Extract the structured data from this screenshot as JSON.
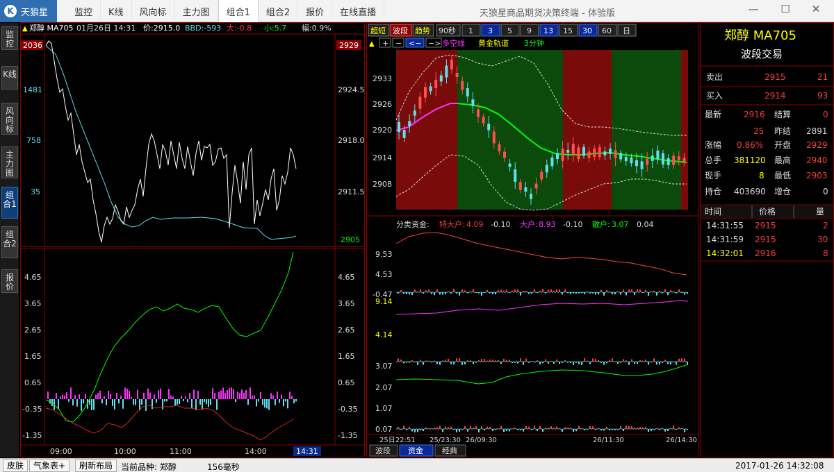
{
  "app": {
    "logo_text": "天狼星",
    "window_title": "天狼星商品期货决策终端 - 体验版",
    "logo_glyph": "K"
  },
  "nav": {
    "tabs": [
      {
        "label": "监控"
      },
      {
        "label": "K线"
      },
      {
        "label": "风向标"
      },
      {
        "label": "主力图"
      },
      {
        "label": "组合1"
      },
      {
        "label": "组合2"
      },
      {
        "label": "报价"
      },
      {
        "label": "在线直播"
      }
    ],
    "active": "组合1"
  },
  "window_controls": {
    "minimize": "—",
    "maximize": "☐",
    "close": "✕"
  },
  "sidebar": {
    "tabs": [
      "监控",
      "K线",
      "风向标",
      "主力图",
      "组合1",
      "组合2",
      "报价"
    ],
    "active": "组合1"
  },
  "intraday": {
    "header": {
      "symbol": "郑醇 MA705",
      "date": "01月26日 14:31",
      "price": "价:2915.0",
      "bbd": "BBD:-593",
      "big": "大:-0.8",
      "small": "小:5.7",
      "amp": "幅:0.9%"
    },
    "left_axis": [
      "2036",
      "1481",
      "758",
      "35"
    ],
    "right_axis": [
      "2929",
      "2924.5",
      "2918.0",
      "2911.5",
      "2905"
    ],
    "bottom_left_axis": [
      "4.65",
      "3.65",
      "2.65",
      "1.65",
      "0.65",
      "-0.35",
      "-1.35"
    ],
    "bottom_right_axis": [
      "4.65",
      "3.65",
      "2.65",
      "1.65",
      "0.65",
      "-0.35",
      "-1.35"
    ],
    "time_axis": [
      "09:00",
      "10:00",
      "11:00",
      "14:00"
    ],
    "cursor_time": "14:31"
  },
  "kline": {
    "toolbar": {
      "mode_buttons": [
        "超短",
        "波段",
        "趋势"
      ],
      "active_mode": "波段",
      "period_label": "90秒",
      "periods": [
        "1",
        "3",
        "5",
        "9",
        "13",
        "15",
        "30",
        "60",
        "日"
      ],
      "active_periods": [
        "3",
        "13",
        "30"
      ]
    },
    "subbar": {
      "icons": [
        "▲",
        "+",
        "−",
        "<−",
        "−>"
      ],
      "labels": [
        "多空线",
        "黄金轨道",
        "3分钟"
      ]
    },
    "price_axis": [
      "2933",
      "2926",
      "2920",
      "2914",
      "2908"
    ]
  },
  "fund": {
    "header": {
      "title": "分类资金:",
      "big_label": "特大户:",
      "big_value": "4.09",
      "big_delta": "-0.10",
      "large_label": "大户:",
      "large_value": "8.93",
      "large_delta": "-0.10",
      "retail_label": "散户:",
      "retail_value": "3.07",
      "retail_delta": "0.04"
    },
    "axis": [
      "9.53",
      "4.53",
      "-0.47",
      "9.14",
      "4.14",
      "3.07",
      "2.07",
      "1.07",
      "0.07"
    ],
    "time_axis": [
      "25日22:51",
      "25/23:30",
      "26/09:30",
      "26/11:30",
      "26/14:30"
    ],
    "tabs": [
      "波段",
      "资金",
      "经典"
    ],
    "active_tab": "资金"
  },
  "quote": {
    "title": "郑醇 MA705",
    "subtitle": "波段交易",
    "ask": {
      "label": "卖出",
      "price": "2915",
      "volume": "21"
    },
    "bid": {
      "label": "买入",
      "price": "2914",
      "volume": "93"
    },
    "rows": [
      {
        "l": "最新",
        "lv": "2916",
        "r": "结算",
        "rv": "0"
      },
      {
        "l": "",
        "lv": "25",
        "r": "昨结",
        "rv": "2891"
      },
      {
        "l": "涨幅",
        "lv": "0.86%",
        "r": "开盘",
        "rv": "2929"
      },
      {
        "l": "总手",
        "lv": "381120",
        "r": "最高",
        "rv": "2940"
      },
      {
        "l": "现手",
        "lv": "8",
        "r": "最低",
        "rv": "2903"
      },
      {
        "l": "持仓",
        "lv": "403690",
        "r": "增仓",
        "rv": "0"
      }
    ],
    "ticks_header": [
      "时间",
      "价格",
      "量"
    ],
    "ticks": [
      {
        "time": "14:31:55",
        "price": "2915",
        "vol": "2"
      },
      {
        "time": "14:31:59",
        "price": "2915",
        "vol": "30"
      },
      {
        "time": "14:32:01",
        "price": "2916",
        "vol": "8"
      }
    ]
  },
  "status": {
    "skin_label": "皮肤",
    "weather_label": "气象表+",
    "refresh_label": "刷新布局",
    "current_label": "当前品种: 郑醇",
    "latency": "156毫秒",
    "datetime": "2017-01-26 14:32:08"
  },
  "colors": {
    "red": "#ff3c3c",
    "green": "#00ff00",
    "cyan": "#5fe0ef",
    "yellow": "#ffff00",
    "magenta": "#ff33ff",
    "white": "#ffffff"
  }
}
